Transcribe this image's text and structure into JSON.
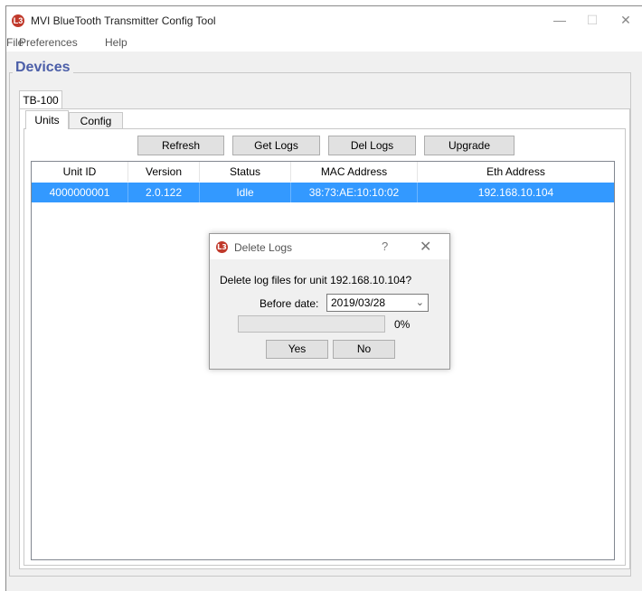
{
  "window": {
    "title": "MVI BlueTooth Transmitter Config Tool",
    "minimize_glyph": "—",
    "maximize_glyph": "☐",
    "close_glyph": "✕"
  },
  "menu": [
    "File",
    "Preferences",
    "Help"
  ],
  "group": {
    "title": "Devices"
  },
  "device_tabs": [
    "TB-100"
  ],
  "sub_tabs": [
    "Units",
    "Config"
  ],
  "toolbar": [
    "Refresh",
    "Get Logs",
    "Del Logs",
    "Upgrade"
  ],
  "table": {
    "columns": [
      "Unit ID",
      "Version",
      "Status",
      "MAC Address",
      "Eth Address"
    ],
    "rows": [
      {
        "unit_id": "4000000001",
        "version": "2.0.122",
        "status": "Idle",
        "mac": "38:73:AE:10:10:02",
        "eth": "192.168.10.104",
        "selected": true
      }
    ]
  },
  "dialog": {
    "title": "Delete Logs",
    "help_glyph": "?",
    "close_glyph": "✕",
    "message": "Delete log files for unit 192.168.10.104?",
    "before_date_label": "Before date:",
    "before_date_value": "2019/03/28",
    "progress": 0,
    "progress_text": "0%",
    "yes_label": "Yes",
    "no_label": "No"
  },
  "colors": {
    "selection": "#3399ff",
    "group_title": "#4b5ea8",
    "app_icon": "#c0392b"
  },
  "icons": {
    "app": "app-logo-icon",
    "dropdown": "chevron-down-icon"
  }
}
